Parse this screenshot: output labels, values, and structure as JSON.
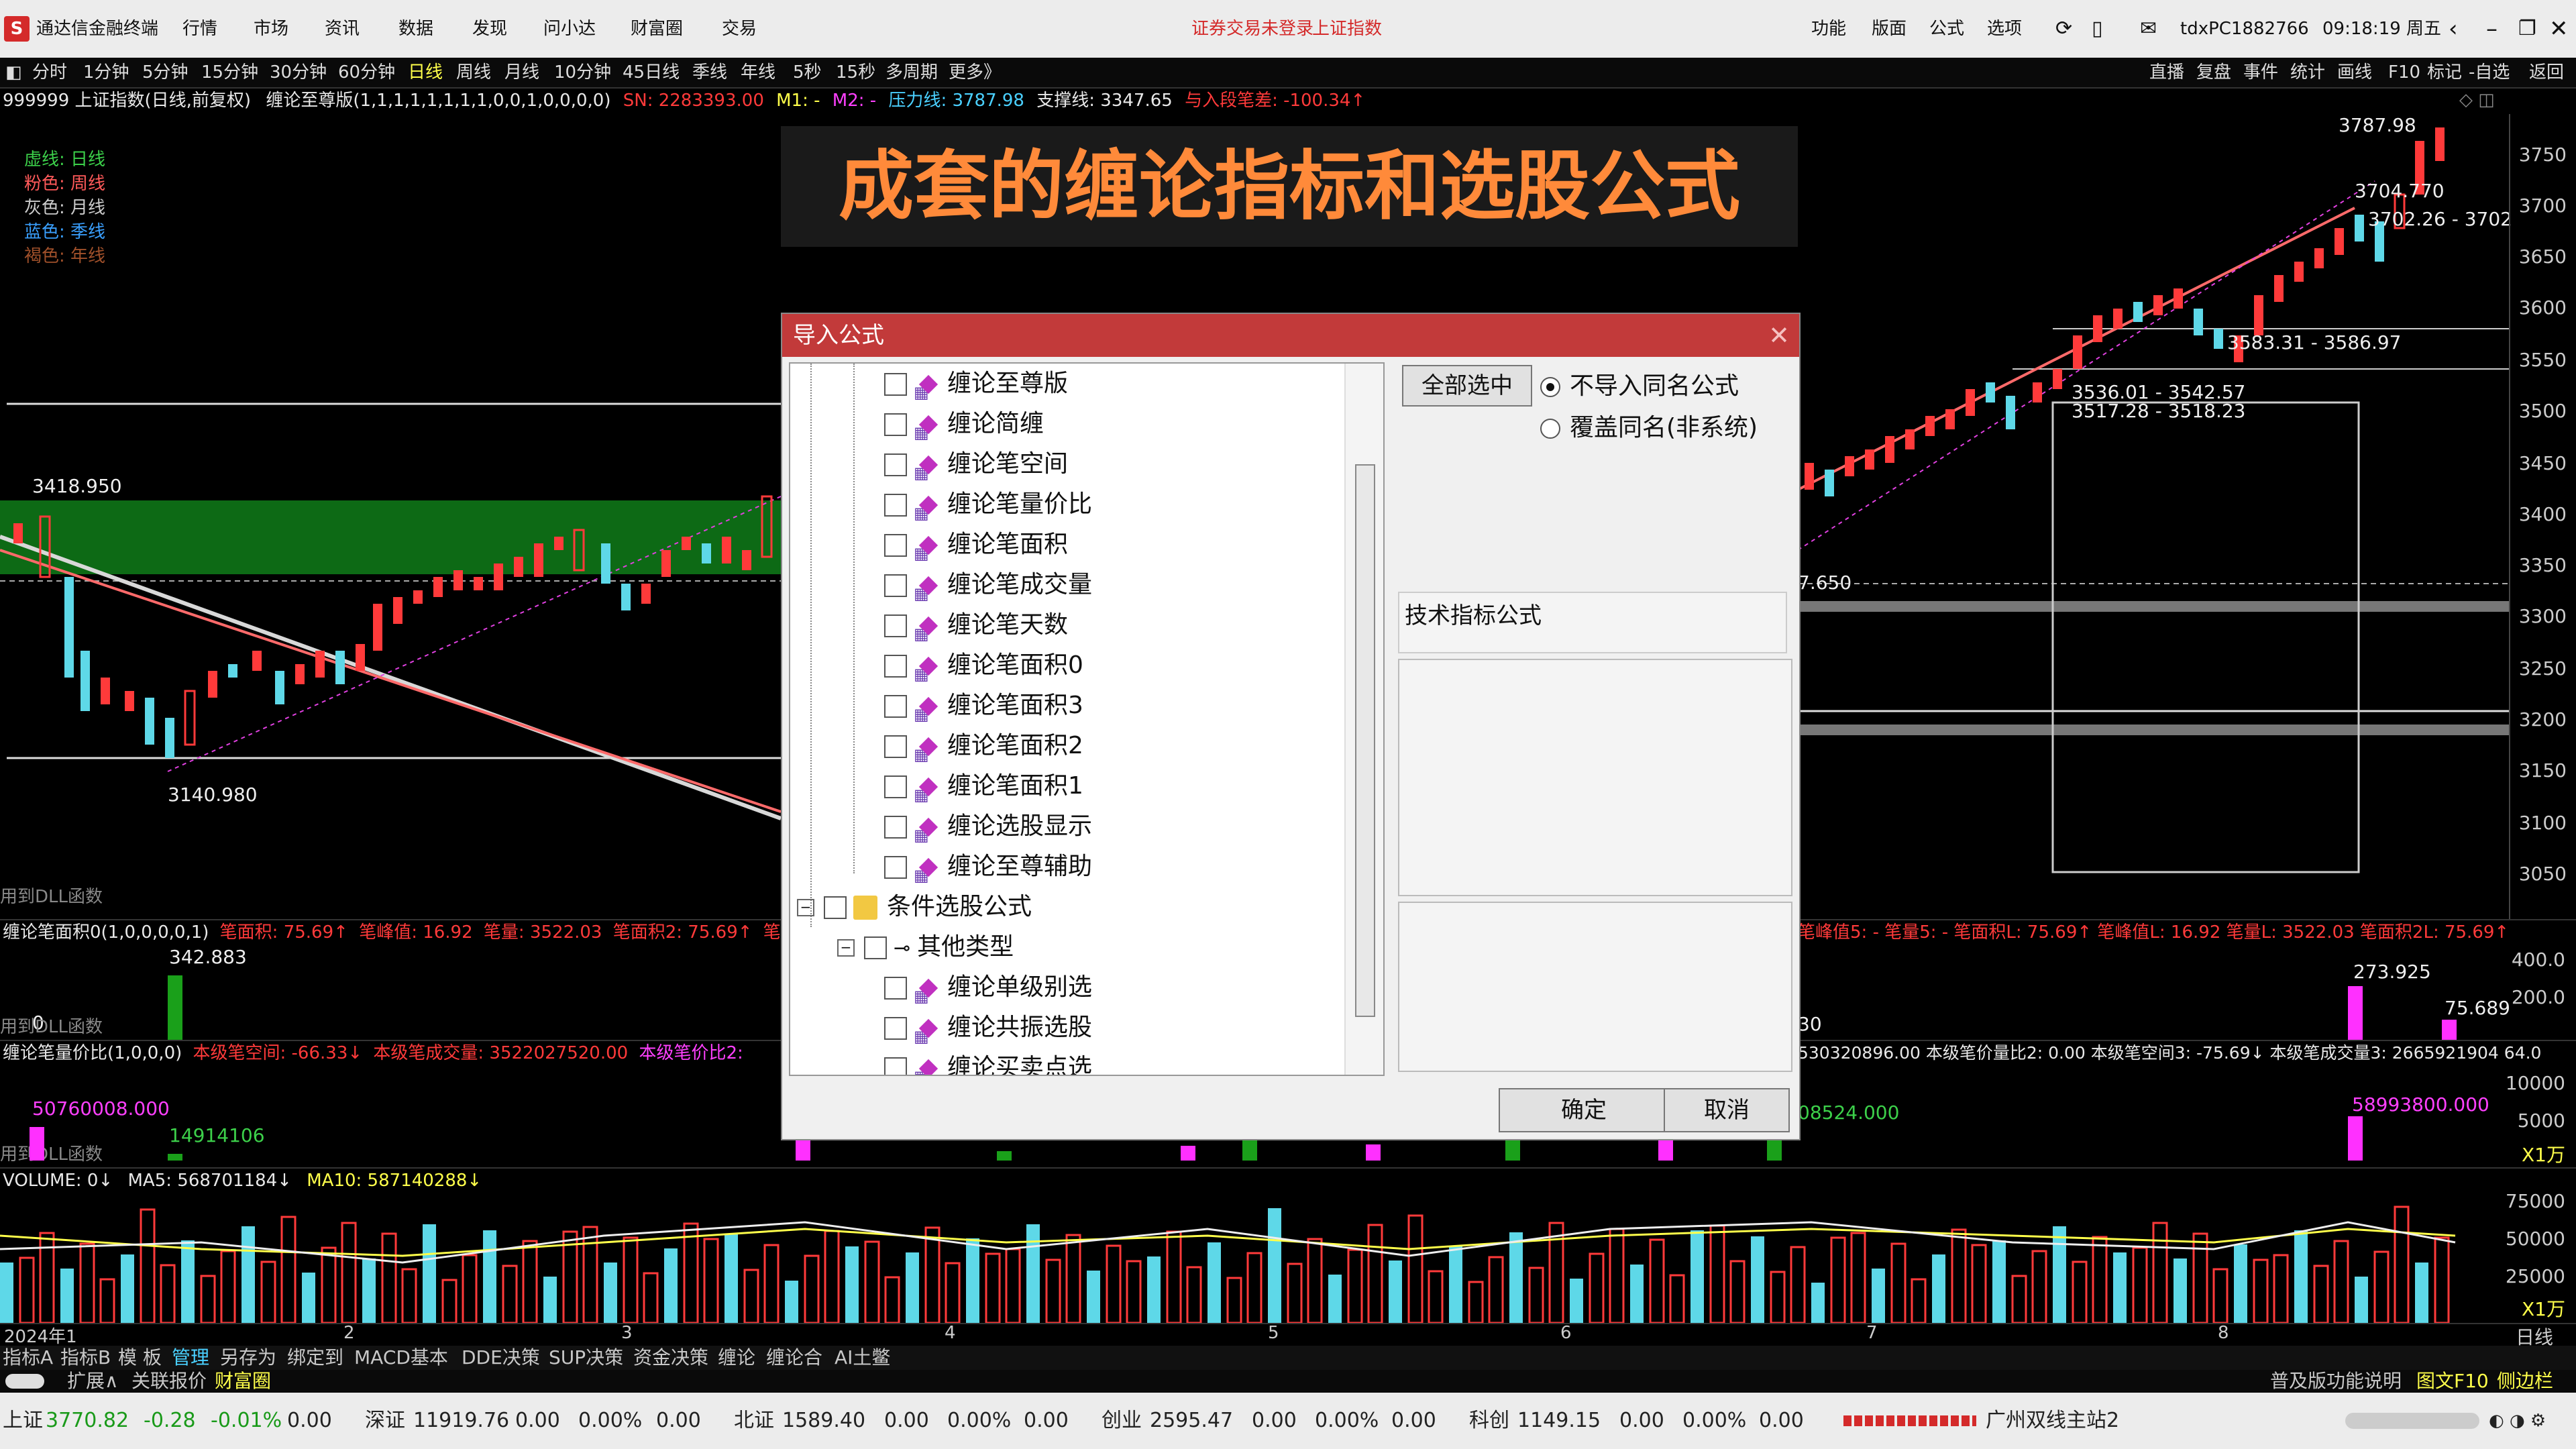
{
  "titlebar": {
    "app_name": "通达信金融终端",
    "menu": [
      "行情",
      "市场",
      "资讯",
      "数据",
      "发现",
      "问小达",
      "财富圈",
      "交易"
    ],
    "login_notice": "证券交易未登录",
    "index_link": "上证指数",
    "right_menu": [
      "功能",
      "版面",
      "公式",
      "选项"
    ],
    "user_id": "tdxPC1882766",
    "clock": "09:18:19 周五",
    "accent": "#d42a2a"
  },
  "period_bar": {
    "items": [
      "分时",
      "1分钟",
      "5分钟",
      "15分钟",
      "30分钟",
      "60分钟",
      "日线",
      "周线",
      "月线",
      "10分钟",
      "45日线",
      "季线",
      "年线",
      "5秒",
      "15秒",
      "多周期",
      "更多》"
    ],
    "active": "日线",
    "right_items": [
      "直播",
      "复盘",
      "事件",
      "统计",
      "画线",
      "F10",
      "标记",
      "-自选",
      "返回"
    ]
  },
  "info_line": {
    "symbol": "999999 上证指数(日线,前复权)",
    "indicator": "缠论至尊版(1,1,1,1,1,1,1,1,0,0,1,0,0,0,0)",
    "sn": "SN: 2283393.00",
    "m1": "M1: -",
    "m2": "M2: -",
    "pressure": "压力线: 3787.98",
    "support": "支撑线: 3347.65",
    "entry": "与入段笔差: -100.34↑"
  },
  "legend": [
    {
      "key": "虚线:",
      "val": "日线",
      "color": "#3cd04a"
    },
    {
      "key": "粉色:",
      "val": "周线",
      "color": "#ff5a5a"
    },
    {
      "key": "灰色:",
      "val": "月线",
      "color": "#cccccc"
    },
    {
      "key": "蓝色:",
      "val": "季线",
      "color": "#3aa0ff"
    },
    {
      "key": "褐色:",
      "val": "年线",
      "color": "#a0502a"
    }
  ],
  "price_labels": {
    "high_left": "3418.950",
    "low_left": "3140.980",
    "peak": "3787.98",
    "p1": "3704.770",
    "p2": "3702.26 - 3702",
    "p3": "3583.31 - 3586.97",
    "p4": "3536.01 - 3542.57",
    "p5": "3517.28 - 3518.23",
    "mid": "7.650"
  },
  "y_axis": [
    "3750",
    "3700",
    "3650",
    "3600",
    "3550",
    "3500",
    "3450",
    "3400",
    "3350",
    "3300",
    "3250",
    "3200",
    "3150",
    "3100",
    "3050"
  ],
  "dll_note": "用到DLL函数",
  "indicator1": {
    "name": "缠论笔面积0(1,0,0,0,0,1)",
    "t1": "笔面积: 75.69↑",
    "t2": "笔峰值: 16.92",
    "t3": "笔量: 3522.03",
    "t4": "笔面积2: 75.69↑",
    "t5": "笔峰",
    "right": "笔峰值5: - 笔量5: - 笔面积L: 75.69↑ 笔峰值L: 16.92 笔量L: 3522.03 笔面积2L: 75.69↑",
    "val_left": "342.883",
    "val_zero": "0",
    "val_r1": "273.925",
    "val_r2": "75.689",
    "axis": [
      "400.0",
      "200.0"
    ],
    "frag": "30"
  },
  "indicator2": {
    "name": "缠论笔量价比(1,0,0,0)",
    "t1": "本级笔空间: -66.33↓",
    "t2": "本级笔成交量: 3522027520.00",
    "t3": "本级笔价比2:",
    "right": "530320896.00 本级笔价量比2: 0.00 本级笔空间3: -75.69↓ 本级笔成交量3: 2665921904 64.0",
    "val_left": "50760008.000",
    "val_left2": "14914106",
    "val_mid": "08524.000",
    "val_right": "58993800.000",
    "axis": [
      "10000",
      "5000",
      "X1万"
    ]
  },
  "volume": {
    "name": "VOLUME: 0↓",
    "ma5": "MA5: 568701184↓",
    "ma10": "MA10: 587140288↓",
    "axis": [
      "75000",
      "50000",
      "25000",
      "X1万"
    ]
  },
  "x_axis": {
    "labels": [
      "2024年1",
      "2",
      "3",
      "4",
      "5",
      "6",
      "7",
      "8"
    ],
    "unit": "日线"
  },
  "bottom_tabs": [
    "指标A",
    "指标B",
    "模 板",
    "管理",
    "另存为",
    "绑定到",
    "MACD基本",
    "DDE决策",
    "SUP决策",
    "资金决策",
    "缠论",
    "缠论合",
    "AI土鳖"
  ],
  "bottom_tabs2": [
    "扩展∧",
    "关联报价",
    "财富圈"
  ],
  "bottom_right": [
    "普及版功能说明",
    "图文F10",
    "侧边栏"
  ],
  "status": [
    {
      "label": "上证",
      "price": "3770.82",
      "chg": "-0.28",
      "pct": "-0.01%",
      "vol": "0.00"
    },
    {
      "label": "深证",
      "price": "11919.76",
      "chg": "0.00",
      "pct": "0.00%",
      "vol": "0.00"
    },
    {
      "label": "北证",
      "price": "1589.40",
      "chg": "0.00",
      "pct": "0.00%",
      "vol": "0.00"
    },
    {
      "label": "创业",
      "price": "2595.47",
      "chg": "0.00",
      "pct": "0.00%",
      "vol": "0.00"
    },
    {
      "label": "科创",
      "price": "1149.15",
      "chg": "0.00",
      "pct": "0.00%",
      "vol": "0.00"
    }
  ],
  "status_right": "广州双线主站2",
  "banner": "成套的缠论指标和选股公式",
  "dialog": {
    "title": "导入公式",
    "items": [
      "缠论至尊版",
      "缠论简缠",
      "缠论笔空间",
      "缠论笔量价比",
      "缠论笔面积",
      "缠论笔成交量",
      "缠论笔天数",
      "缠论笔面积0",
      "缠论笔面积3",
      "缠论笔面积2",
      "缠论笔面积1",
      "缠论选股显示",
      "缠论至尊辅助"
    ],
    "folder": "条件选股公式",
    "subfolder": "其他类型",
    "sub_items": [
      "缠论单级别选",
      "缠论共振选股",
      "缠论买卖点选"
    ],
    "select_all": "全部选中",
    "radio1": "不导入同名公式",
    "radio2": "覆盖同名(非系统)",
    "section": "技术指标公式",
    "ok": "确定",
    "cancel": "取消"
  }
}
